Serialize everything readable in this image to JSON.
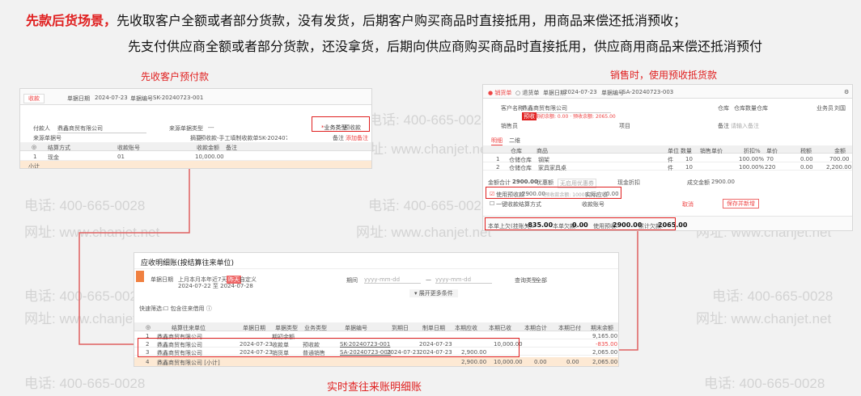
{
  "headline": {
    "title": "先款后货场景，",
    "line1": "先收取客户全额或者部分货款，没有发货，后期客户购买商品时直接抵用，用商品来偿还抵消预收；",
    "line2": "先支付供应商全额或者部分货款，还没拿货，后期向供应商购买商品时直接抵用，供应商用商品来偿还抵消预付"
  },
  "captions": {
    "receipt": "先收客户预付款",
    "sales": "销售时，使用预收抵货款",
    "ledger": "实时查往来账明细账"
  },
  "watermark": {
    "phone": "电话: 400-665-0028",
    "site": "网址: www.chanjet.net"
  },
  "receipt": {
    "tab": "收款",
    "date_label": "单据日期",
    "date": "2024-07-23",
    "no_label": "单据编号",
    "no": "SK-20240723-001",
    "payer_label": "付款人",
    "payer": "鼎鑫商贸有限公司",
    "src_type_label": "来源单据类型",
    "src_type": "---",
    "biz_type_label": "业务类型",
    "biz_type": "预收款",
    "src_no_label": "来源单据号",
    "summary_label": "摘要",
    "summary": "预收款-手工填制收款单SK-20240723-001的款项",
    "remark_label": "备注",
    "add_note": "添加备注",
    "cols": [
      "结算方式",
      "收款账号",
      "收款金额",
      "备注"
    ],
    "row_no": "1",
    "row": [
      "现金",
      "01",
      "10,000.00",
      ""
    ],
    "total_label": "小计"
  },
  "sales": {
    "tabs": [
      "销货单",
      "退货单"
    ],
    "date_label": "单据日期",
    "date": "2024-07-23",
    "no_label": "单据编号",
    "no": "SA-20240723-003",
    "customer_label": "客户名称",
    "customer": "鼎鑫商贸有限公司",
    "credit_tag": "预收",
    "credit_text": "期初余额: 0.00 · 预收余额: 2065.00",
    "warehouse_label": "仓库",
    "warehouse": "仓库数量仓库",
    "salesman_label": "业务员",
    "salesman": "刘国",
    "sales_staff_label": "销售员",
    "project_label": "项目",
    "remark_label": "备注",
    "remark_ph": "请输入备注",
    "subtabs": [
      "明细",
      "二维"
    ],
    "cols": [
      "仓库",
      "商品",
      "单位",
      "数量",
      "销售单价",
      "折扣%",
      "单价",
      "税额",
      "金额"
    ],
    "rows": [
      [
        "1",
        "仓储仓库",
        "钢架",
        "件",
        "10",
        "100.00%",
        "70",
        "0.00",
        "700.00"
      ],
      [
        "2",
        "仓储仓库",
        "家具家具桌",
        "件",
        "10",
        "100.00%",
        "220",
        "0.00",
        "2,200.00"
      ]
    ],
    "amount_label": "金额合计",
    "amount": "2900.00",
    "discount_label": "优惠额",
    "discount_ph": "无启用优惠券",
    "pretax_label": "现金折扣",
    "after_label": "成交金额",
    "after": "2900.00",
    "use_prepay_label": "使用预收款",
    "use_prepay": "2900.00",
    "use_prepay_hint": "(预收款余额: 10000.00)",
    "received_label": "实际应收",
    "received": "0.00",
    "settle_label": "一键收款",
    "settle_type_label": "结算方式",
    "account_label": "收款账号",
    "btn_cancel": "取消",
    "btn_save": "保存并新增",
    "footer": [
      {
        "label": "本单上欠(挂账欠):",
        "value": "-835.00"
      },
      {
        "label": "本单欠款:",
        "value": "0.00"
      },
      {
        "label": "使用预收:",
        "value": "2900.00"
      },
      {
        "label": "累计欠款:",
        "value": "2065.00"
      }
    ]
  },
  "ledger": {
    "title": "应收明细账(按结算往来单位)",
    "date_label": "单据日期",
    "quick": [
      "上月",
      "本月",
      "本年",
      "近7天",
      "昨天",
      "自定义"
    ],
    "active_quick": "昨天",
    "range": "2024-07-22 至 2024-07-28",
    "due_label": "期间",
    "date_ph": "yyyy-mm-dd",
    "query_label": "查询类型",
    "query": "全部",
    "expand": "展开更多条件",
    "filter_label": "快速筛选:",
    "filter_opt": "包含往来借用",
    "cols": [
      "结算往来单位",
      "单据日期",
      "单据类型",
      "业务类型",
      "单据编号",
      "到期日",
      "制单日期",
      "本期应收",
      "本期已收",
      "本期合计",
      "本期已付",
      "期末余额"
    ],
    "rows": [
      [
        "1",
        "鼎鑫商贸有限公司",
        "",
        "期初余额",
        "",
        "",
        "",
        "",
        "",
        "",
        "",
        "",
        "9,165.00"
      ],
      [
        "2",
        "鼎鑫商贸有限公司",
        "2024-07-23",
        "收款单",
        "预收款",
        "SK-20240723-001",
        "",
        "2024-07-23",
        "",
        "10,000.00",
        "",
        "",
        "-835.00"
      ],
      [
        "3",
        "鼎鑫商贸有限公司",
        "2024-07-23",
        "销货单",
        "普通销售",
        "SA-20240723-003",
        "2024-07-23",
        "2024-07-23",
        "2,900.00",
        "",
        "",
        "",
        "2,065.00"
      ]
    ],
    "total": [
      "4",
      "鼎鑫商贸有限公司 [小计]",
      "",
      "",
      "",
      "",
      "",
      "",
      "2,900.00",
      "10,000.00",
      "0.00",
      "0.00",
      "2,065.00"
    ]
  }
}
